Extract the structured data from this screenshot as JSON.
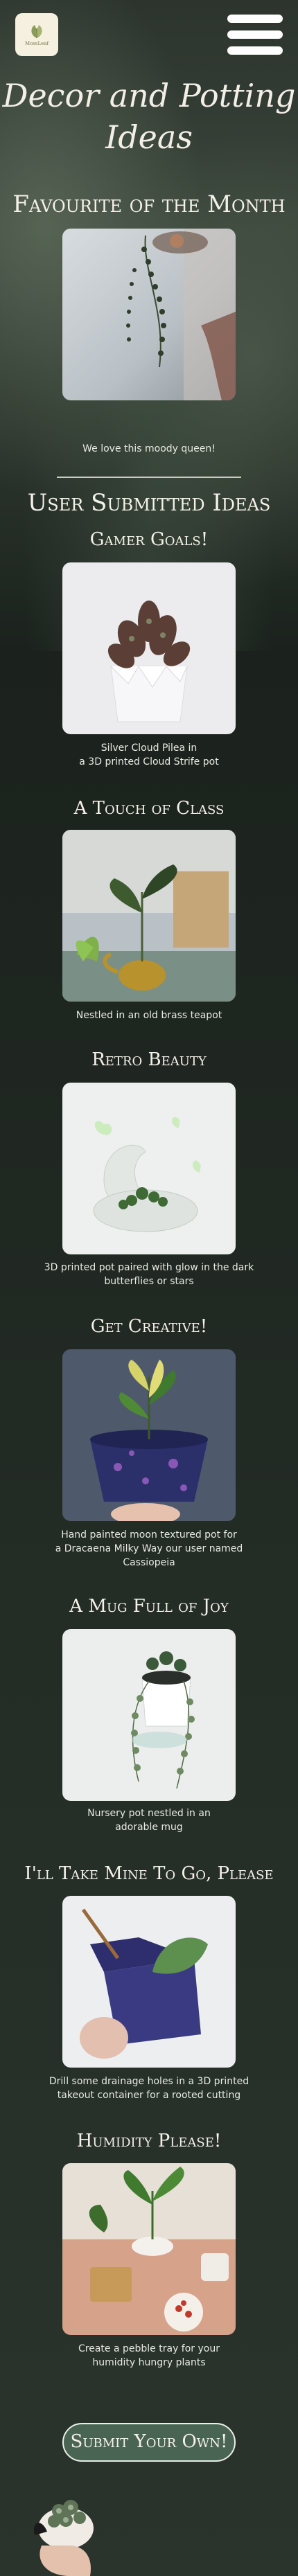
{
  "header": {
    "logo_text": "MossLeaf",
    "menu_icon": "hamburger-menu-icon"
  },
  "page_title_line1": "Decor and Potting",
  "page_title_line2": "Ideas",
  "featured": {
    "heading": "Favourite of the Month",
    "caption": "We love this moody queen!"
  },
  "submitted_heading": "User Submitted Ideas",
  "ideas": [
    {
      "title": "Gamer Goals!",
      "caption_line1": "Silver Cloud Pilea in",
      "caption_line2": "a 3D printed Cloud Strife pot"
    },
    {
      "title": "A Touch of Class",
      "caption_line1": "Nestled in an old brass teapot",
      "caption_line2": ""
    },
    {
      "title": "Retro Beauty",
      "caption_line1": "3D printed pot paired with glow in the dark",
      "caption_line2": "butterflies or stars"
    },
    {
      "title": "Get Creative!",
      "caption_line1": "Hand painted moon textured pot for",
      "caption_line2": "a Dracaena Milky Way our user named Cassiopeia"
    },
    {
      "title": "A Mug Full of Joy",
      "caption_line1": "Nursery pot nestled in an",
      "caption_line2": "adorable mug"
    },
    {
      "title": "I'll Take Mine To Go, Please",
      "caption_line1": "Drill some drainage holes in a 3D printed",
      "caption_line2": "takeout container for a rooted cutting"
    },
    {
      "title": "Humidity Please!",
      "caption_line1": "Create a pebble tray for your",
      "caption_line2": "humidity hungry plants"
    }
  ],
  "submit_button": "Submit Your Own!"
}
